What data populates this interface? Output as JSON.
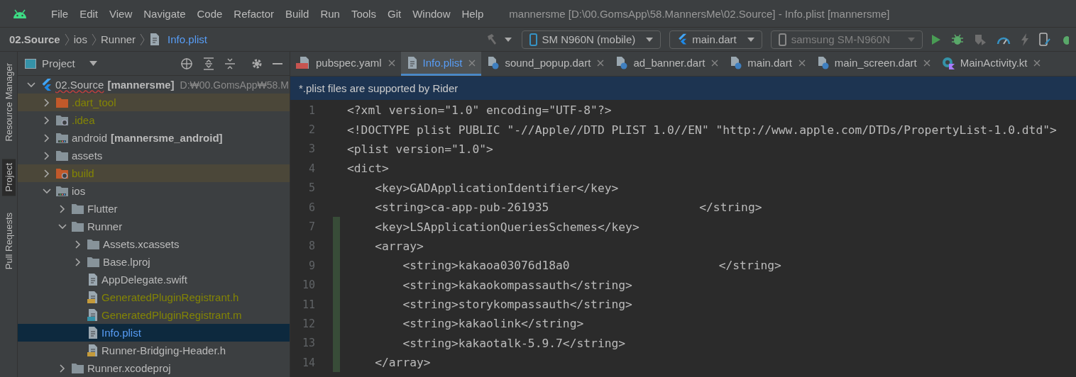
{
  "menu": [
    "File",
    "Edit",
    "View",
    "Navigate",
    "Code",
    "Refactor",
    "Build",
    "Run",
    "Tools",
    "Git",
    "Window",
    "Help"
  ],
  "window_title": "mannersme [D:\\00.GomsApp\\58.MannersMe\\02.Source] - Info.plist [mannersme]",
  "breadcrumbs": [
    {
      "label": "02.Source",
      "kind": "root"
    },
    {
      "label": "ios",
      "kind": "folder"
    },
    {
      "label": "Runner",
      "kind": "folder"
    },
    {
      "label": "Info.plist",
      "kind": "file"
    }
  ],
  "run_toolbar": {
    "device": "SM N960N (mobile)",
    "config": "main.dart",
    "target": "samsung SM-N960N",
    "target_disabled": true
  },
  "side_tabs": [
    {
      "label": "Resource Manager",
      "selected": false
    },
    {
      "label": "Project",
      "selected": true
    },
    {
      "label": "Pull Requests",
      "selected": false
    }
  ],
  "project_panel": {
    "title": "Project"
  },
  "tree": [
    {
      "label": "02.Source",
      "tag": "[mannersme]",
      "path": "D:₩00.GomsApp₩58.M",
      "kind": "project",
      "excluded": false,
      "ignored": false,
      "selected": false,
      "expanded": true,
      "children": [
        {
          "label": ".dart_tool",
          "kind": "folder",
          "excluded": true,
          "selected": false,
          "expanded": false
        },
        {
          "label": ".idea",
          "kind": "config",
          "excluded": false,
          "ignored": true,
          "selected": false,
          "expanded": false
        },
        {
          "label": "android",
          "tag": "[mannersme_android]",
          "kind": "module",
          "excluded": false,
          "ignored": false,
          "selected": false,
          "expanded": false
        },
        {
          "label": "assets",
          "kind": "folder",
          "excluded": false,
          "ignored": false,
          "selected": false,
          "expanded": false
        },
        {
          "label": "build",
          "kind": "config",
          "excluded": true,
          "selected": false,
          "expanded": false
        },
        {
          "label": "ios",
          "kind": "module",
          "excluded": false,
          "ignored": false,
          "selected": false,
          "expanded": true,
          "children": [
            {
              "label": "Flutter",
              "kind": "folder",
              "excluded": false,
              "ignored": false,
              "selected": false,
              "expanded": false
            },
            {
              "label": "Runner",
              "kind": "folder",
              "excluded": false,
              "ignored": false,
              "selected": false,
              "expanded": true,
              "children": [
                {
                  "label": "Assets.xcassets",
                  "kind": "folder",
                  "excluded": false,
                  "ignored": false,
                  "selected": false,
                  "expanded": false
                },
                {
                  "label": "Base.lproj",
                  "kind": "folder",
                  "excluded": false,
                  "ignored": false,
                  "selected": false,
                  "expanded": false
                },
                {
                  "label": "AppDelegate.swift",
                  "kind": "file",
                  "excluded": false,
                  "ignored": false,
                  "selected": false
                },
                {
                  "label": "GeneratedPluginRegistrant.h",
                  "kind": "header",
                  "excluded": false,
                  "ignored": true,
                  "selected": false
                },
                {
                  "label": "GeneratedPluginRegistrant.m",
                  "kind": "source",
                  "excluded": false,
                  "ignored": true,
                  "selected": false
                },
                {
                  "label": "Info.plist",
                  "kind": "file",
                  "excluded": false,
                  "ignored": false,
                  "selected": true
                },
                {
                  "label": "Runner-Bridging-Header.h",
                  "kind": "header",
                  "excluded": false,
                  "ignored": false,
                  "selected": false
                }
              ]
            },
            {
              "label": "Runner.xcodeproj",
              "kind": "folder",
              "excluded": false,
              "ignored": false,
              "selected": false,
              "expanded": false
            }
          ]
        }
      ]
    }
  ],
  "editor_tabs": [
    {
      "label": "pubspec.yaml",
      "kind": "yaml",
      "selected": false
    },
    {
      "label": "Info.plist",
      "kind": "file",
      "selected": true
    },
    {
      "label": "sound_popup.dart",
      "kind": "dart",
      "selected": false
    },
    {
      "label": "ad_banner.dart",
      "kind": "dart",
      "selected": false
    },
    {
      "label": "main.dart",
      "kind": "dart",
      "selected": false
    },
    {
      "label": "main_screen.dart",
      "kind": "dart",
      "selected": false
    },
    {
      "label": "MainActivity.kt",
      "kind": "kotlin",
      "selected": false
    }
  ],
  "banner": "*.plist files are supported by Rider",
  "code_lines": [
    {
      "number": "1",
      "text": "<?xml version=\"1.0\" encoding=\"UTF-8\"?>",
      "changed": false
    },
    {
      "number": "2",
      "text": "<!DOCTYPE plist PUBLIC \"-//Apple//DTD PLIST 1.0//EN\" \"http://www.apple.com/DTDs/PropertyList-1.0.dtd\">",
      "changed": false
    },
    {
      "number": "3",
      "text": "<plist version=\"1.0\">",
      "changed": false
    },
    {
      "number": "4",
      "text": "<dict>",
      "changed": false
    },
    {
      "number": "5",
      "text": "    <key>GADApplicationIdentifier</key>",
      "changed": false
    },
    {
      "number": "6",
      "text": "    <string>ca-app-pub-261935",
      "tail": "</string>",
      "changed": false
    },
    {
      "number": "7",
      "text": "    <key>LSApplicationQueriesSchemes</key>",
      "changed": true
    },
    {
      "number": "8",
      "text": "    <array>",
      "changed": true
    },
    {
      "number": "9",
      "text": "        <string>kakaoa03076d18a0",
      "tail": "</string>",
      "changed": true
    },
    {
      "number": "10",
      "text": "        <string>kakaokompassauth</string>",
      "changed": true
    },
    {
      "number": "11",
      "text": "        <string>storykompassauth</string>",
      "changed": true
    },
    {
      "number": "12",
      "text": "        <string>kakaolink</string>",
      "changed": true
    },
    {
      "number": "13",
      "text": "        <string>kakaotalk-5.9.7</string>",
      "changed": true
    },
    {
      "number": "14",
      "text": "    </array>",
      "changed": true
    }
  ]
}
